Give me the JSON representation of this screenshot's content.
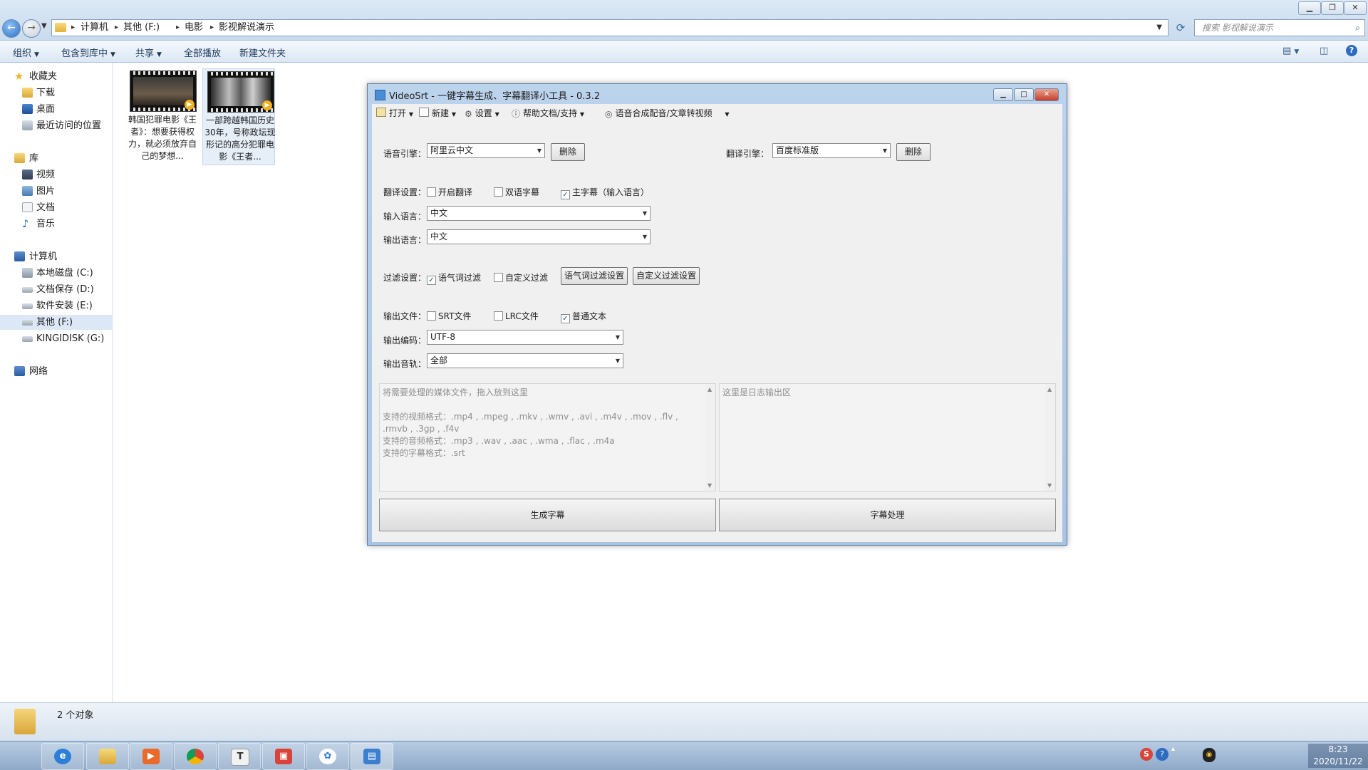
{
  "explorer": {
    "breadcrumbs": [
      "计算机",
      "其他 (F:)",
      "电影",
      "影视解说演示"
    ],
    "search_placeholder": "搜索 影视解说演示",
    "toolbar": [
      {
        "label": "组织",
        "has_menu": true
      },
      {
        "label": "包含到库中",
        "has_menu": true
      },
      {
        "label": "共享",
        "has_menu": true
      },
      {
        "label": "全部播放",
        "has_menu": false
      },
      {
        "label": "新建文件夹",
        "has_menu": false
      }
    ],
    "nav": {
      "favorites": {
        "label": "收藏夹",
        "items": [
          "下载",
          "桌面",
          "最近访问的位置"
        ]
      },
      "libraries": {
        "label": "库",
        "items": [
          "视频",
          "图片",
          "文档",
          "音乐"
        ]
      },
      "computer": {
        "label": "计算机",
        "items": [
          "本地磁盘 (C:)",
          "文档保存 (D:)",
          "软件安装 (E:)",
          "其他 (F:)",
          "KINGIDISK (G:)"
        ]
      },
      "network": {
        "label": "网络"
      }
    },
    "files": [
      {
        "name": "韩国犯罪电影《王者》：想要获得权力，就必须放弃自己的梦想..."
      },
      {
        "name": "一部跨越韩国历史30年，号称政坛现形记的高分犯罪电影《王者..."
      }
    ],
    "status_text": "2 个对象",
    "clock": {
      "time": "8:23",
      "date": "2020/11/22"
    }
  },
  "app": {
    "title": "VideoSrt - 一键字幕生成、字幕翻译小工具 - 0.3.2",
    "menu": [
      {
        "label": "打开",
        "icon": "folder-open-icon"
      },
      {
        "label": "新建",
        "icon": "new-file-icon"
      },
      {
        "label": "设置",
        "icon": "gear-icon"
      },
      {
        "label": "帮助文档/支持",
        "icon": "info-icon"
      },
      {
        "label": "语音合成配音/文章转视频",
        "icon": "speech-icon"
      }
    ],
    "speech_engine": {
      "label": "语音引擎：",
      "value": "阿里云中文",
      "delete_label": "删除"
    },
    "translate_engine": {
      "label": "翻译引擎：",
      "value": "百度标准版",
      "delete_label": "删除"
    },
    "translate_settings": {
      "label": "翻译设置：",
      "options": [
        {
          "label": "开启翻译",
          "checked": false
        },
        {
          "label": "双语字幕",
          "checked": false
        },
        {
          "label": "主字幕（输入语言）",
          "checked": true
        }
      ]
    },
    "input_language": {
      "label": "输入语言：",
      "value": "中文"
    },
    "output_language": {
      "label": "输出语言：",
      "value": "中文"
    },
    "filter_settings": {
      "label": "过滤设置：",
      "options": [
        {
          "label": "语气词过滤",
          "checked": true
        },
        {
          "label": "自定义过滤",
          "checked": false
        }
      ],
      "buttons": [
        "语气词过滤设置",
        "自定义过滤设置"
      ]
    },
    "output_files": {
      "label": "输出文件：",
      "options": [
        {
          "label": "SRT文件",
          "checked": false
        },
        {
          "label": "LRC文件",
          "checked": false
        },
        {
          "label": "普通文本",
          "checked": true
        }
      ]
    },
    "output_encoding": {
      "label": "输出编码：",
      "value": "UTF-8"
    },
    "output_track": {
      "label": "输出音轨：",
      "value": "全部"
    },
    "drop_area_text": "将需要处理的媒体文件，拖入放到这里\n\n支持的视频格式：.mp4 , .mpeg , .mkv , .wmv , .avi , .m4v , .mov , .flv , .rmvb , .3gp , .f4v\n支持的音频格式：.mp3 , .wav , .aac , .wma , .flac , .m4a\n支持的字幕格式：.srt",
    "log_area_text": "这里是日志输出区",
    "generate_button": "生成字幕",
    "process_button": "字幕处理"
  },
  "colors": {
    "explorer_chrome": "#c9dbee",
    "app_frame": "#a9c4e3",
    "taskbar": "#8ea9c8",
    "close_red": "#c4402a"
  }
}
